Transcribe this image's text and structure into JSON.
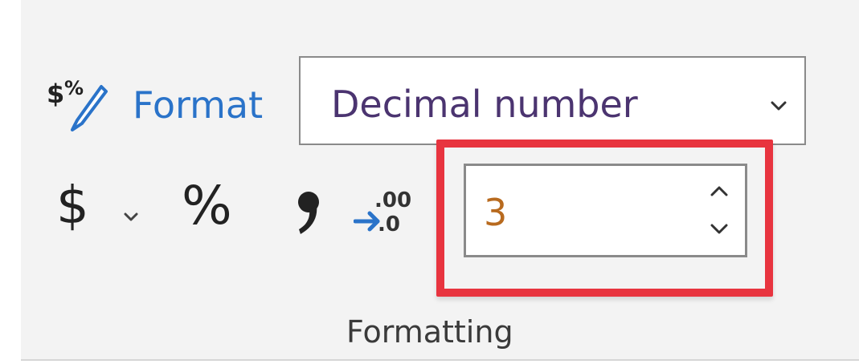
{
  "format": {
    "icon": "currency-percent-format-icon",
    "label": "Format",
    "selected": "Decimal number",
    "chevron_icon": "chevron-down-icon"
  },
  "number_buttons": {
    "currency_symbol": "$",
    "currency_icon": "dollar-sign-icon",
    "currency_dropdown_icon": "chevron-down-icon",
    "percent_symbol": "%",
    "percent_icon": "percent-icon",
    "comma_icon": "comma-style-icon",
    "decimal_icon": "decimal-places-icon",
    "decimal_icon_top": ".00",
    "decimal_icon_bottom": ".0"
  },
  "decimal_stepper": {
    "value": "3",
    "up_icon": "chevron-up-icon",
    "down_icon": "chevron-down-icon",
    "highlighted": true
  },
  "group": {
    "label": "Formatting"
  },
  "colors": {
    "ribbon_background": "#f3f3f3",
    "format_label": "#2a73c9",
    "select_text": "#4b3470",
    "stepper_value": "#b86a1e",
    "highlight": "#e8343f",
    "border": "#8a8a8a"
  }
}
